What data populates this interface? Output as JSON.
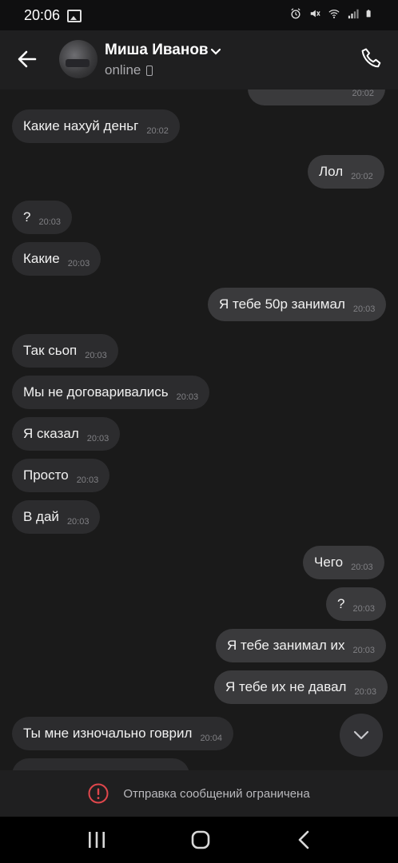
{
  "status_bar": {
    "time": "20:06",
    "icons": [
      "image-icon",
      "alarm-icon",
      "mute-icon",
      "wifi-icon",
      "signal-icon",
      "battery-icon"
    ]
  },
  "header": {
    "contact_name": "Миша Иванов",
    "status": "online",
    "icons": [
      "back-arrow-icon",
      "chevron-down-icon",
      "mobile-device-icon",
      "phone-call-icon"
    ]
  },
  "messages": [
    {
      "dir": "out",
      "text": "",
      "time": "20:02"
    },
    {
      "dir": "in",
      "text": "Какие нахуй деньг",
      "time": "20:02"
    },
    {
      "dir": "out",
      "text": "Лол",
      "time": "20:02"
    },
    {
      "dir": "in",
      "text": "?",
      "time": "20:03"
    },
    {
      "dir": "in",
      "text": "Какие",
      "time": "20:03"
    },
    {
      "dir": "out",
      "text": "Я тебе 50р занимал",
      "time": "20:03"
    },
    {
      "dir": "in",
      "text": "Так сьоп",
      "time": "20:03"
    },
    {
      "dir": "in",
      "text": "Мы не договаривались",
      "time": "20:03"
    },
    {
      "dir": "in",
      "text": "Я сказал",
      "time": "20:03"
    },
    {
      "dir": "in",
      "text": "Просто",
      "time": "20:03"
    },
    {
      "dir": "in",
      "text": "В дай",
      "time": "20:03"
    },
    {
      "dir": "out",
      "text": "Чего",
      "time": "20:03"
    },
    {
      "dir": "out",
      "text": "?",
      "time": "20:03"
    },
    {
      "dir": "out",
      "text": "Я тебе занимал их",
      "time": "20:03"
    },
    {
      "dir": "out",
      "text": "Я тебе их не давал",
      "time": "20:03"
    },
    {
      "dir": "in",
      "text": "Ты мне изночально говрил",
      "time": "20:04"
    },
    {
      "dir": "in",
      "text": "",
      "time": ""
    }
  ],
  "scroll_button": {
    "icon": "chevron-down-icon"
  },
  "restriction": {
    "text": "Отправка сообщений ограничена",
    "icon": "warning-circle-icon"
  },
  "nav_bar": {
    "icons": [
      "recent-apps-icon",
      "home-icon",
      "back-icon"
    ]
  }
}
